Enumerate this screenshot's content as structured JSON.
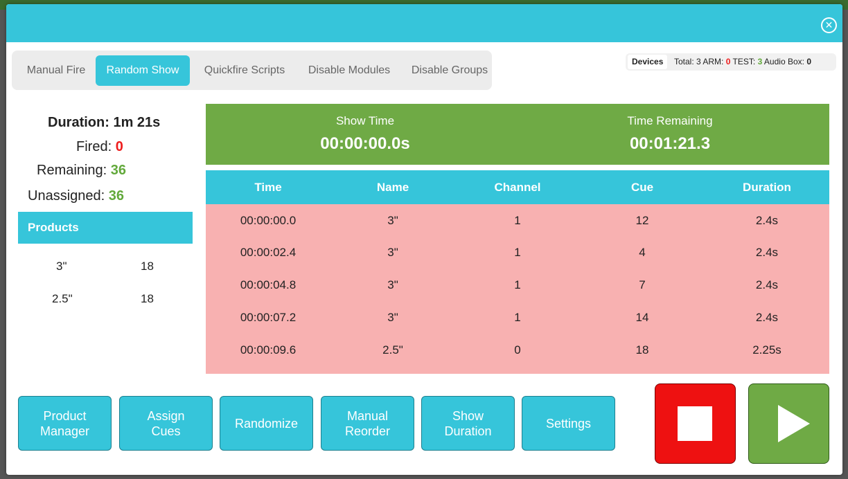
{
  "tabs": [
    {
      "label": "Manual Fire",
      "active": false
    },
    {
      "label": "Random Show",
      "active": true
    },
    {
      "label": "Quickfire Scripts",
      "active": false
    },
    {
      "label": "Disable Modules",
      "active": false
    },
    {
      "label": "Disable Groups",
      "active": false
    }
  ],
  "devices": {
    "label": "Devices",
    "total_label": "Total:",
    "total_value": "3",
    "arm_label": "ARM:",
    "arm_value": "0",
    "test_label": "TEST:",
    "test_value": "3",
    "audio_label": "Audio Box:",
    "audio_value": "0"
  },
  "summary": {
    "duration_label": "Duration:",
    "duration_value": "1m 21s",
    "fired_label": "Fired:",
    "fired_value": "0",
    "remaining_label": "Remaining:",
    "remaining_value": "36",
    "unassigned_label": "Unassigned:",
    "unassigned_value": "36"
  },
  "products": {
    "header": "Products",
    "rows": [
      {
        "name": "3\"",
        "count": "18"
      },
      {
        "name": "2.5\"",
        "count": "18"
      }
    ]
  },
  "timer": {
    "show_time_label": "Show Time",
    "show_time_value": "00:00:00.0s",
    "remaining_label": "Time Remaining",
    "remaining_value": "00:01:21.3"
  },
  "cue_table": {
    "columns": [
      "Time",
      "Name",
      "Channel",
      "Cue",
      "Duration"
    ],
    "rows": [
      [
        "00:00:00.0",
        "3\"",
        "1",
        "12",
        "2.4s"
      ],
      [
        "00:00:02.4",
        "3\"",
        "1",
        "4",
        "2.4s"
      ],
      [
        "00:00:04.8",
        "3\"",
        "1",
        "7",
        "2.4s"
      ],
      [
        "00:00:07.2",
        "3\"",
        "1",
        "14",
        "2.4s"
      ],
      [
        "00:00:09.6",
        "2.5\"",
        "0",
        "18",
        "2.25s"
      ]
    ]
  },
  "buttons": {
    "product_manager": "Product\nManager",
    "assign_cues": "Assign\nCues",
    "randomize": "Randomize",
    "manual_reorder": "Manual\nReorder",
    "show_duration": "Show\nDuration",
    "settings": "Settings"
  },
  "icons": {
    "close": "close-circle-icon",
    "stop": "stop-square-icon",
    "play": "play-triangle-icon"
  },
  "colors": {
    "accent": "#36c5da",
    "timer_green": "#6faa45",
    "row_pink": "#f8b1b1",
    "stop_red": "#ee1111",
    "value_red": "#ee1c1c",
    "value_green": "#62a93b"
  }
}
